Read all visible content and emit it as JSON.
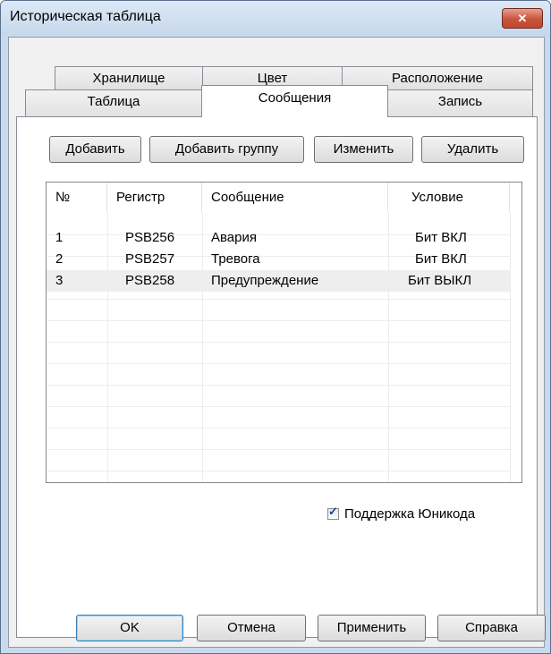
{
  "window": {
    "title": "Историческая таблица",
    "close_glyph": "✕"
  },
  "tabs": {
    "row_back": [
      {
        "label": "Хранилище"
      },
      {
        "label": "Цвет"
      },
      {
        "label": "Расположение"
      }
    ],
    "row_front": [
      {
        "label": "Таблица"
      },
      {
        "label": "Сообщения"
      },
      {
        "label": "Запись"
      }
    ],
    "active": "Сообщения"
  },
  "toolbar": {
    "add": "Добавить",
    "add_group": "Добавить группу",
    "edit": "Изменить",
    "delete": "Удалить"
  },
  "table": {
    "columns": [
      "№",
      "Регистр",
      "Сообщение",
      "Условие"
    ],
    "rows": [
      {
        "num": "1",
        "register": "PSB256",
        "message": "Авария",
        "condition": "Бит ВКЛ"
      },
      {
        "num": "2",
        "register": "PSB257",
        "message": "Тревога",
        "condition": "Бит ВКЛ"
      },
      {
        "num": "3",
        "register": "PSB258",
        "message": "Предупреждение",
        "condition": "Бит ВЫКЛ"
      }
    ],
    "selected_row": "3"
  },
  "unicode": {
    "label": "Поддержка Юникода",
    "checked": true
  },
  "footer": {
    "ok": "OK",
    "cancel": "Отмена",
    "apply": "Применить",
    "help": "Справка"
  }
}
